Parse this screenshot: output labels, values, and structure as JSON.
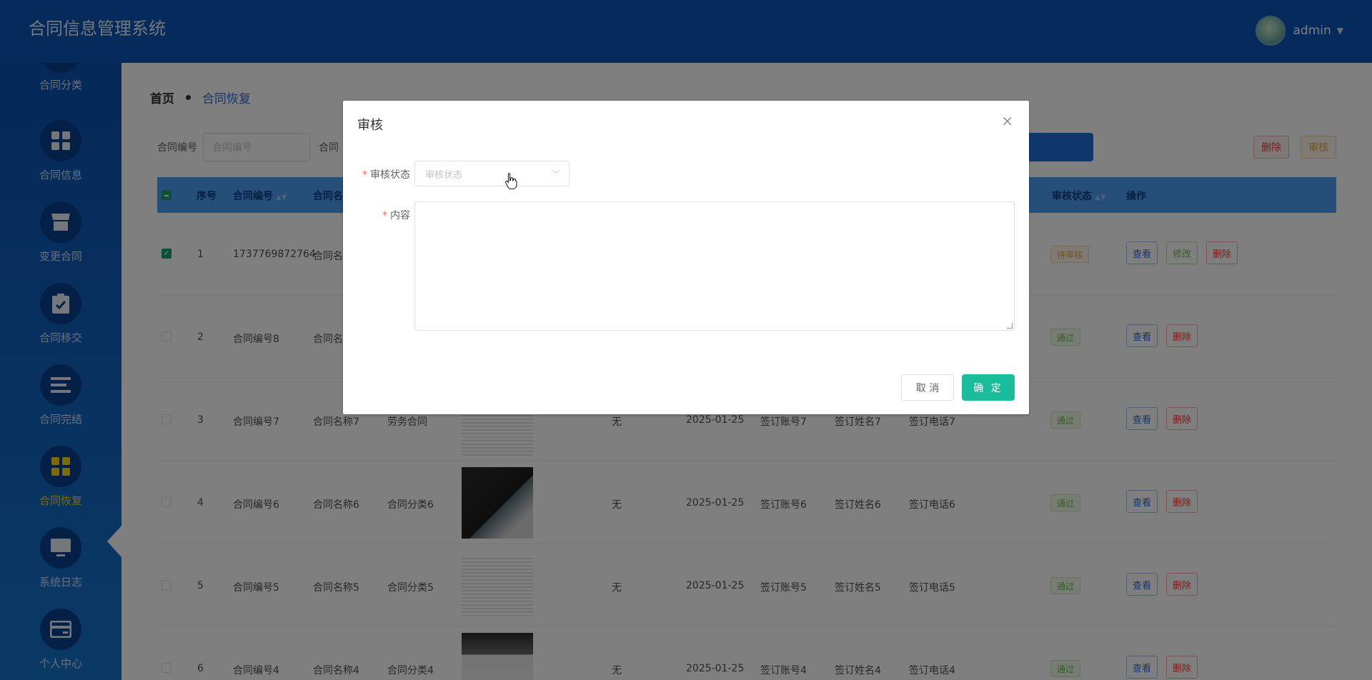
{
  "header": {
    "title": "合同信息管理系统",
    "user_name": "admin"
  },
  "sidebar": {
    "items": [
      {
        "label": "合同分类",
        "icon": "grid-icon"
      },
      {
        "label": "合同信息",
        "icon": "grid-icon"
      },
      {
        "label": "变更合同",
        "icon": "store-icon"
      },
      {
        "label": "合同移交",
        "icon": "clipboard-check-icon"
      },
      {
        "label": "合同完结",
        "icon": "list-icon"
      },
      {
        "label": "合同恢复",
        "icon": "grid-icon",
        "active": true
      },
      {
        "label": "系统日志",
        "icon": "monitor-icon"
      },
      {
        "label": "个人中心",
        "icon": "card-icon"
      }
    ]
  },
  "breadcrumb": {
    "home": "首页",
    "current": "合同恢复"
  },
  "search": {
    "label1": "合同编号",
    "placeholder1": "合同编号",
    "label2": "合同"
  },
  "toolbar": {
    "delete_label": "删除",
    "audit_label": "审核"
  },
  "table": {
    "headers": {
      "index": "序号",
      "code": "合同编号",
      "name": "合同名",
      "status": "审核状态",
      "ops": "操作"
    },
    "rows": [
      {
        "index": "1",
        "code": "1737769872764",
        "name": "合同名",
        "category": "",
        "remark": "",
        "date": "",
        "account": "",
        "signer": "",
        "phone": "",
        "status": "待审核",
        "status_type": "wait",
        "checked": true,
        "thumb": "none"
      },
      {
        "index": "2",
        "code": "合同编号8",
        "name": "合同名",
        "category": "",
        "remark": "",
        "date": "",
        "account": "",
        "signer": "",
        "phone": "",
        "status": "通过",
        "status_type": "pass",
        "checked": false,
        "thumb": "none"
      },
      {
        "index": "3",
        "code": "合同编号7",
        "name": "合同名称7",
        "category": "劳务合同",
        "remark": "无",
        "date": "2025-01-25",
        "account": "签订账号7",
        "signer": "签订姓名7",
        "phone": "签订电话7",
        "status": "通过",
        "status_type": "pass",
        "checked": false,
        "thumb": "paper"
      },
      {
        "index": "4",
        "code": "合同编号6",
        "name": "合同名称6",
        "category": "合同分类6",
        "remark": "无",
        "date": "2025-01-25",
        "account": "签订账号6",
        "signer": "签订姓名6",
        "phone": "签订电话6",
        "status": "通过",
        "status_type": "pass",
        "checked": false,
        "thumb": "book"
      },
      {
        "index": "5",
        "code": "合同编号5",
        "name": "合同名称5",
        "category": "合同分类5",
        "remark": "无",
        "date": "2025-01-25",
        "account": "签订账号5",
        "signer": "签订姓名5",
        "phone": "签订电话5",
        "status": "通过",
        "status_type": "pass",
        "checked": false,
        "thumb": "paper"
      },
      {
        "index": "6",
        "code": "合同编号4",
        "name": "合同名称4",
        "category": "合同分类4",
        "remark": "无",
        "date": "2025-01-25",
        "account": "签订账号4",
        "signer": "签订姓名4",
        "phone": "签订电话4",
        "status": "通过",
        "status_type": "pass",
        "checked": false,
        "thumb": "photo"
      }
    ],
    "op_view": "查看",
    "op_edit": "修改",
    "op_delete": "删除"
  },
  "dialog": {
    "title": "审核",
    "status_label": "审核状态",
    "status_placeholder": "审核状态",
    "content_label": "内容",
    "cancel_label": "取 消",
    "ok_label": "确 定"
  },
  "colors": {
    "header": "#0a57b9",
    "active_nav": "#f8d718",
    "confirm": "#1abc9c",
    "table_head": "#4b9ef0"
  }
}
